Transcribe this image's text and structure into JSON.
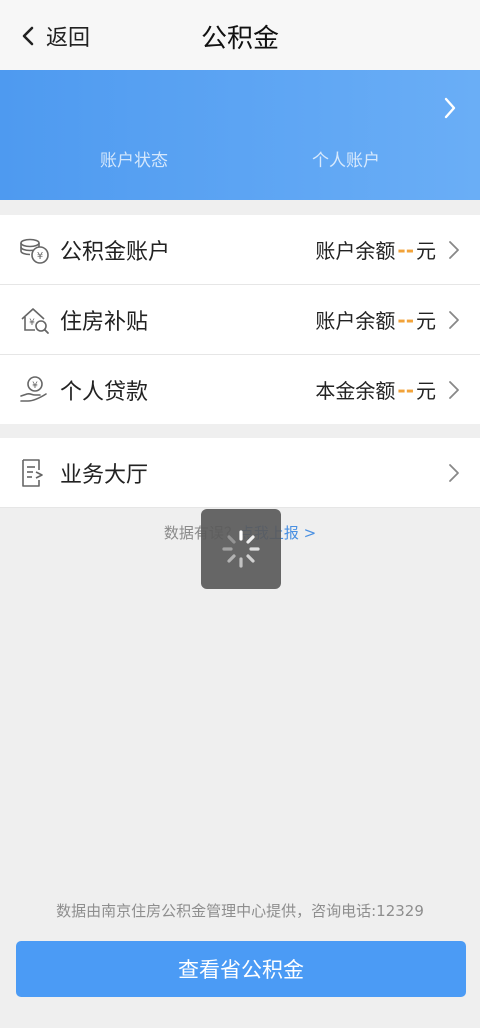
{
  "nav": {
    "back_label": "返回",
    "title": "公积金"
  },
  "banner": {
    "status_label": "账户状态",
    "account_label": "个人账户"
  },
  "items": [
    {
      "label": "公积金账户",
      "right_prefix": "账户余额",
      "right_value": "--",
      "right_suffix": "元",
      "icon": "coins-icon"
    },
    {
      "label": "住房补贴",
      "right_prefix": "账户余额",
      "right_value": "--",
      "right_suffix": "元",
      "icon": "house-search-icon"
    },
    {
      "label": "个人贷款",
      "right_prefix": "本金余额",
      "right_value": "--",
      "right_suffix": "元",
      "icon": "hand-money-icon"
    }
  ],
  "hall": {
    "label": "业务大厅",
    "icon": "document-arrow-icon"
  },
  "report": {
    "question": "数据有误？",
    "link": "点我上报 >"
  },
  "footer": {
    "note": "数据由南京住房公积金管理中心提供，咨询电话:12329",
    "cta": "查看省公积金"
  },
  "colors": {
    "accent": "#4b9bf5",
    "dash": "#f2a33a",
    "link": "#4a90e2"
  }
}
